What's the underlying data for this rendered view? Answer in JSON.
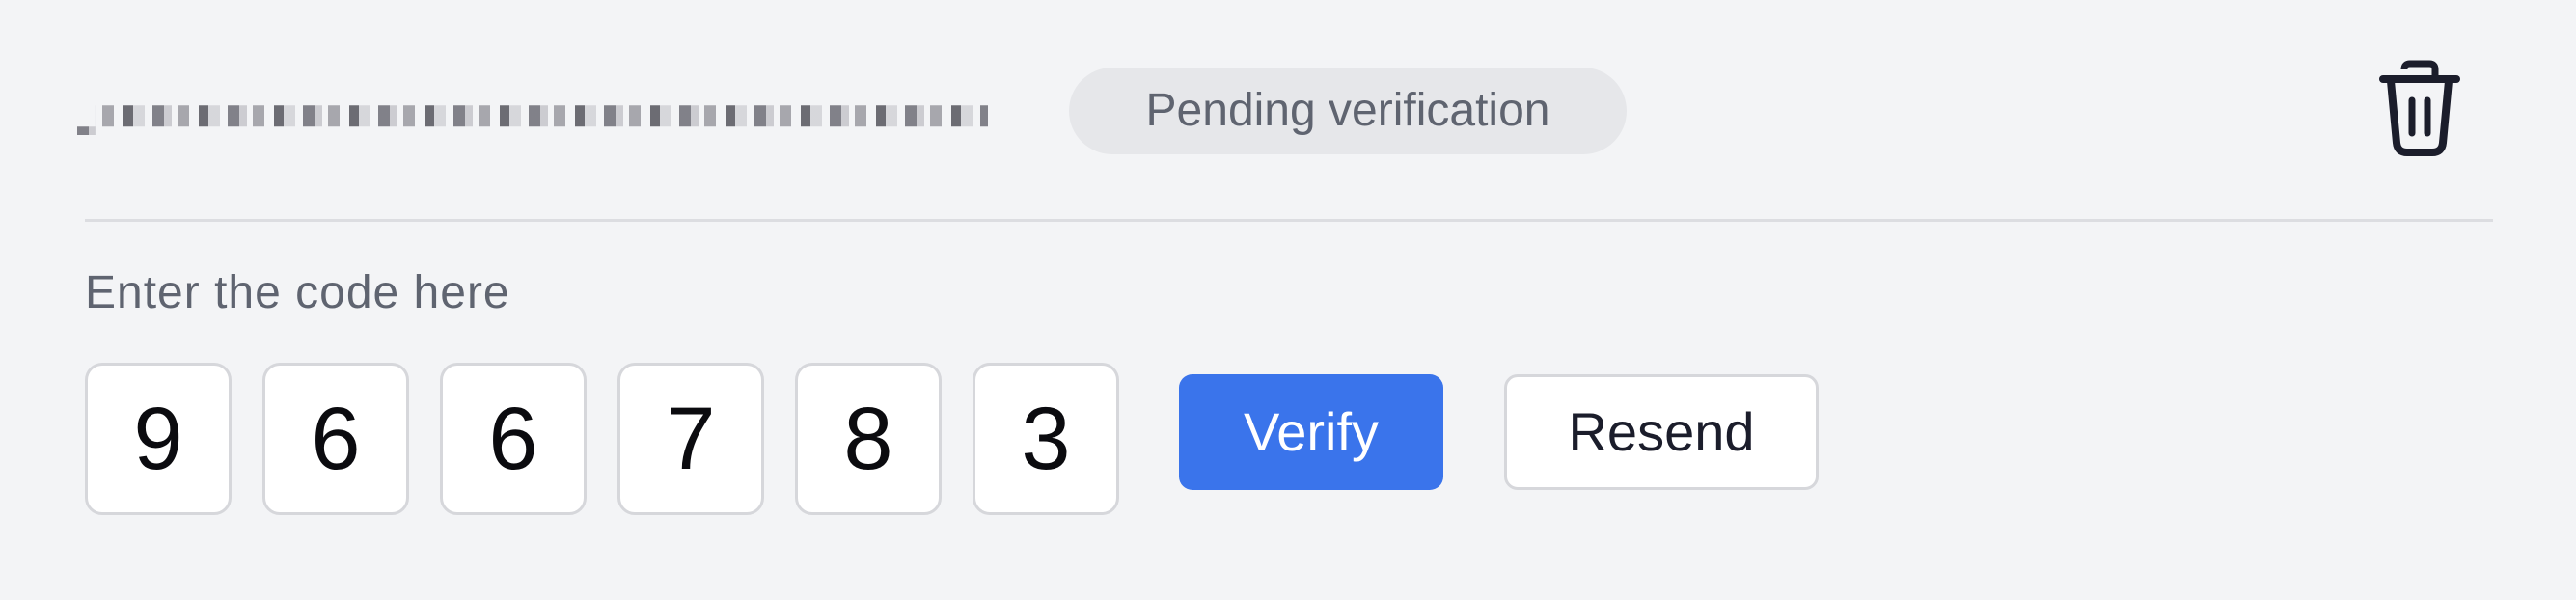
{
  "email": {
    "value": "redacted-email-address"
  },
  "status_badge": {
    "label": "Pending verification"
  },
  "delete": {
    "icon": "trash-icon"
  },
  "code": {
    "label": "Enter the code here",
    "digits": [
      "9",
      "6",
      "6",
      "7",
      "8",
      "3"
    ]
  },
  "actions": {
    "verify_label": "Verify",
    "resend_label": "Resend"
  },
  "colors": {
    "background": "#f3f4f6",
    "accent": "#3a74eb",
    "badge_bg": "#e6e7ea",
    "muted_text": "#5f6470",
    "icon": "#1b1d2b"
  }
}
